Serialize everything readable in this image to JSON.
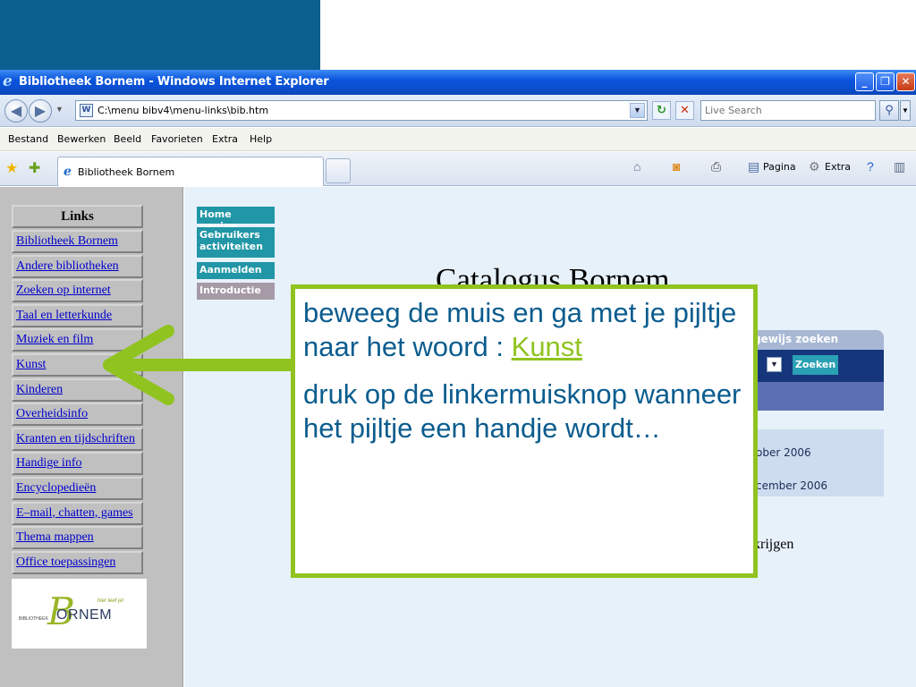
{
  "window": {
    "title": "Bibliotheek Bornem - Windows Internet Explorer",
    "min_glyph": "_",
    "max_glyph": "❐",
    "close_glyph": "✕"
  },
  "address_bar": {
    "url": "C:\\menu bibv4\\menu-links\\bib.htm",
    "search_placeholder": "Live Search"
  },
  "menu": [
    "Bestand",
    "Bewerken",
    "Beeld",
    "Favorieten",
    "Extra",
    "Help"
  ],
  "tab": {
    "label": "Bibliotheek Bornem"
  },
  "command_bar": {
    "page_label": "Pagina",
    "tools_label": "Extra"
  },
  "left_frame": {
    "heading": "Links",
    "items": [
      "Bibliotheek Bornem",
      "Andere bibliotheken",
      "Zoeken op internet",
      "Taal en letterkunde",
      "Muziek en film",
      "Kunst",
      "Kinderen",
      "Overheidsinfo",
      "Kranten en tijdschriften",
      "Handige info",
      "Encyclopedieën",
      "E–mail, chatten, games",
      "Thema mappen",
      "Office toepassingen"
    ],
    "logo": {
      "name": "ORNEM",
      "initial": "B",
      "small": "BIBLIOTHEEK",
      "slogan": "hier leef je!"
    }
  },
  "main_frame": {
    "top_nav": [
      {
        "label": "Home pagina"
      },
      {
        "label": "Gebruikers activiteiten"
      },
      {
        "label": "Aanmelden"
      },
      {
        "label": "Introductie"
      }
    ],
    "heading": "Catalogus Bornem",
    "search_panel_title": "gewijs zoeken",
    "search_button": "Zoeken",
    "news": [
      "ober 2006",
      "cember 2006"
    ],
    "trailing_text": "krijgen"
  },
  "callout": {
    "line1": "beweeg de muis en ga met je pijltje naar het woord : ",
    "keyword": "Kunst",
    "line2": "druk op de linkermuisknop wanneer het pijltje een handje wordt…"
  },
  "colors": {
    "accent_green": "#90c31f",
    "callout_text": "#0b5c8e",
    "slide_bar": "#0a5f8e"
  }
}
